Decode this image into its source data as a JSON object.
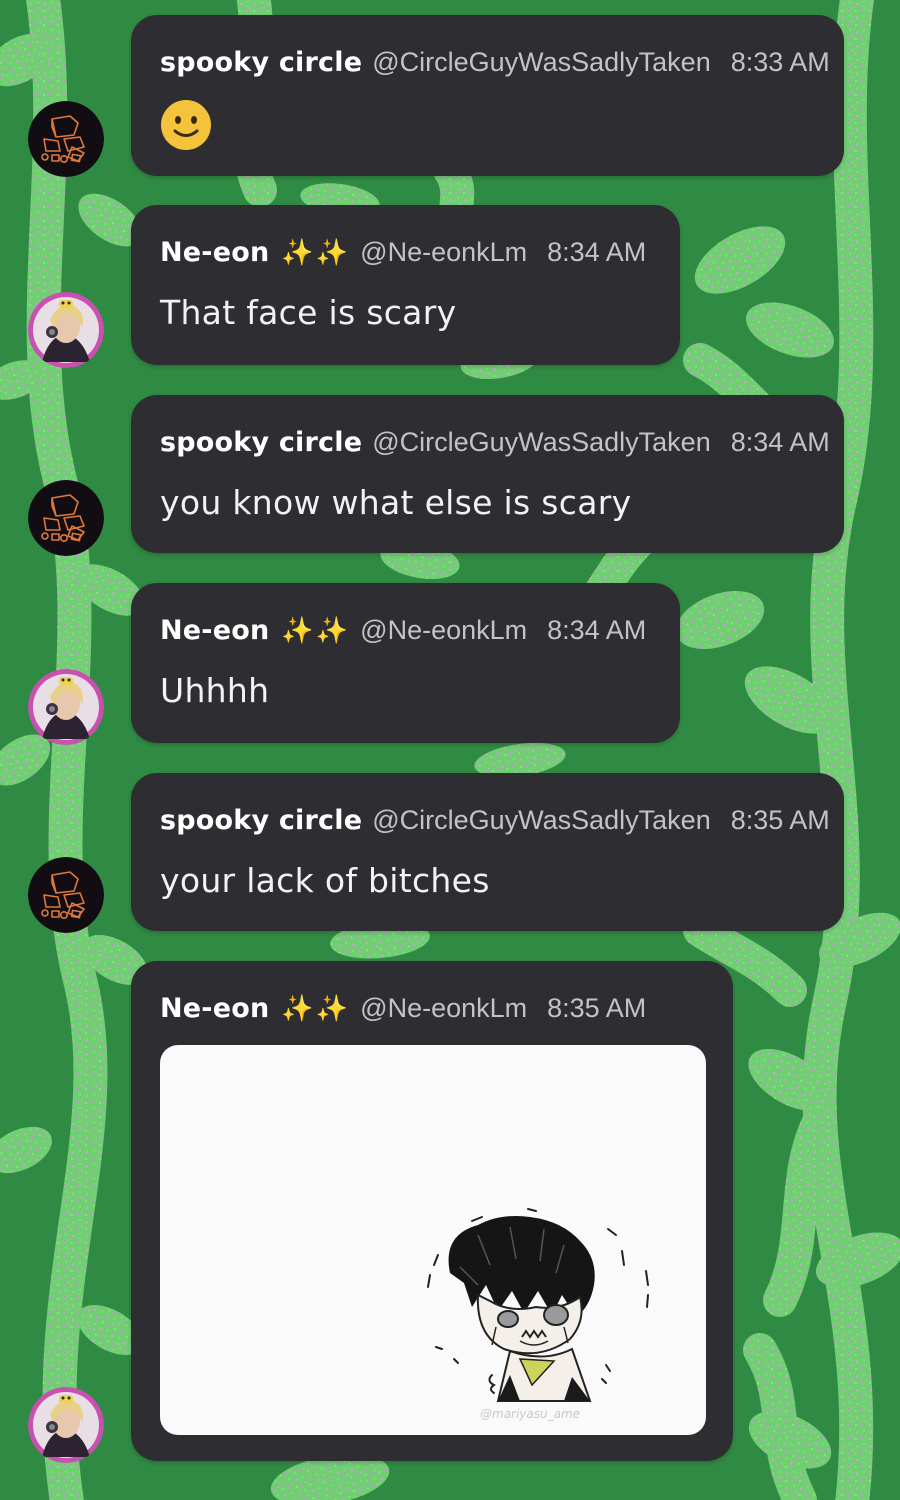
{
  "messages": [
    {
      "author": "spooky circle",
      "handle": "@CircleGuyWasSadlyTaken",
      "time": "8:33 AM",
      "avatar": "box-sketch-avatar",
      "emoji": "slightly-smiling-face",
      "text": ""
    },
    {
      "author": "Ne-eon",
      "sparkles": "✨✨",
      "handle": "@Ne-eonkLm",
      "time": "8:34 AM",
      "avatar": "anime-character-avatar",
      "text": "That face is scary"
    },
    {
      "author": "spooky circle",
      "handle": "@CircleGuyWasSadlyTaken",
      "time": "8:34 AM",
      "avatar": "box-sketch-avatar",
      "text": "you know what else is scary"
    },
    {
      "author": "Ne-eon",
      "sparkles": "✨✨",
      "handle": "@Ne-eonkLm",
      "time": "8:34 AM",
      "avatar": "anime-character-avatar",
      "text": "Uhhhh"
    },
    {
      "author": "spooky circle",
      "handle": "@CircleGuyWasSadlyTaken",
      "time": "8:35 AM",
      "avatar": "box-sketch-avatar",
      "text": "your lack of bitches"
    },
    {
      "author": "Ne-eon",
      "sparkles": "✨✨",
      "handle": "@Ne-eonkLm",
      "time": "8:35 AM",
      "avatar": "anime-character-avatar",
      "image": "sketch-crying-character",
      "image_watermark": "@mariyasu_ame"
    }
  ],
  "colors": {
    "background_dark_green": "#2f8a43",
    "background_light_green": "#6ccf6b",
    "speckle_pink": "#d59ad9",
    "bubble": "#2e2d31",
    "name_text": "#ffffff",
    "meta_text": "#c2c2c8",
    "sparkle": "#f6c531",
    "emoji_yellow": "#f5c33b",
    "ring_pink": "#c94fb0"
  }
}
